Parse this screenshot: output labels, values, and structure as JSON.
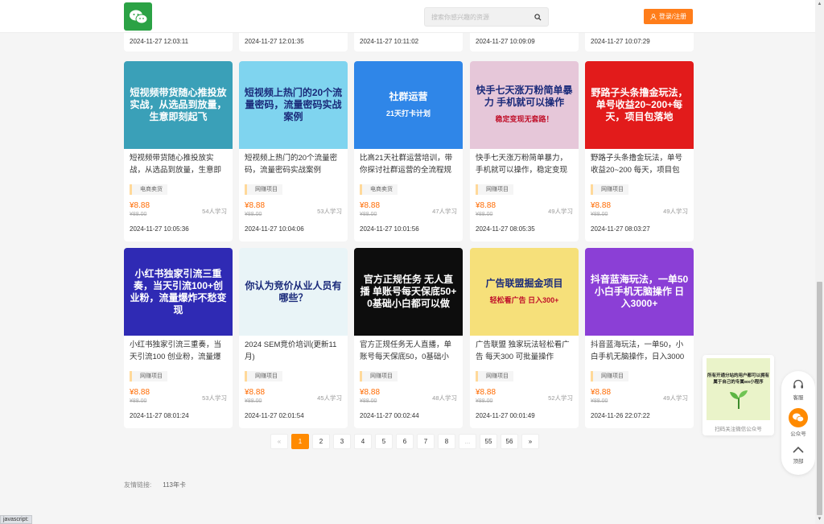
{
  "header": {
    "search_placeholder": "搜索你感兴趣的资源",
    "login_label": "登录/注册"
  },
  "top_dates": [
    "2024-11-27 12:03:11",
    "2024-11-27 12:01:35",
    "2024-11-27 10:11:02",
    "2024-11-27 10:09:09",
    "2024-11-27 10:07:29"
  ],
  "cards": [
    {
      "thumb_text": "短视频带货随心推投放实战，从选品到放量，生意即刻起飞",
      "thumb_bg": "#3aa0b8",
      "title": "短视频带货随心推投放实战，从选品到放量，生意即",
      "tag": "电商卖货",
      "price": "¥8.88",
      "old_price": "¥88.00",
      "learners": "54人学习",
      "date": "2024-11-27 10:05:36"
    },
    {
      "thumb_text": "短视频上热门的20个流量密码，流量密码实战案例",
      "thumb_bg": "#7fd4ef",
      "title": "短视频上热门的20个流量密码，流量密码实战案例",
      "tag": "网赚项目",
      "price": "¥8.88",
      "old_price": "¥88.00",
      "learners": "53人学习",
      "date": "2024-11-27 10:04:06"
    },
    {
      "thumb_text": "社群运营",
      "thumb_sub": "21天打卡计划",
      "thumb_bg": "#2f86e8",
      "title": "比高21天社群运营培训，带你探讨社群运营的全流程规",
      "tag": "电商卖货",
      "price": "¥8.88",
      "old_price": "¥88.00",
      "learners": "47人学习",
      "date": "2024-11-27 10:01:56"
    },
    {
      "thumb_text": "快手七天涨万粉简单暴力 手机就可以操作",
      "thumb_sub": "稳定变现无套路！",
      "thumb_bg": "#e6c7d9",
      "title": "快手七天涨万粉简单暴力，手机就可以操作，稳定变现",
      "tag": "网赚项目",
      "price": "¥8.88",
      "old_price": "¥88.00",
      "learners": "49人学习",
      "date": "2024-11-27 08:05:35"
    },
    {
      "thumb_text": "野路子头条撸金玩法，单号收益20~200+每天，项目包落地",
      "thumb_bg": "#e21b1b",
      "title": "野路子头条撸金玩法，单号收益20~200 每天，项目包",
      "tag": "网赚项目",
      "price": "¥8.88",
      "old_price": "¥88.00",
      "learners": "49人学习",
      "date": "2024-11-27 08:03:27"
    },
    {
      "thumb_text": "小红书独家引流三重奏，当天引流100+创业粉，流量爆炸不愁变现",
      "thumb_bg": "#2f2ab4",
      "title": "小红书独家引流三重奏，当天引流100 创业粉，流量爆",
      "tag": "网赚项目",
      "price": "¥8.88",
      "old_price": "¥88.00",
      "learners": "53人学习",
      "date": "2024-11-27 08:01:24"
    },
    {
      "thumb_text": "你认为竞价从业人员有哪些？",
      "thumb_bg": "#e9f4f7",
      "title": "2024 SEM竞价培训(更新11月)",
      "tag": "网赚项目",
      "price": "¥8.88",
      "old_price": "¥88.00",
      "learners": "45人学习",
      "date": "2024-11-27 02:01:54"
    },
    {
      "thumb_text": "官方正规任务 无人直播 单账号每天保底50+ 0基础小白都可以做",
      "thumb_bg": "#0d0d0d",
      "title": "官方正规任务无人直播，单账号每天保底50，0基础小",
      "tag": "网赚项目",
      "price": "¥8.88",
      "old_price": "¥88.00",
      "learners": "48人学习",
      "date": "2024-11-27 00:02:44"
    },
    {
      "thumb_text": "广告联盟掘金项目",
      "thumb_sub": "轻松看广告 日入300+",
      "thumb_bg": "#f6e07a",
      "title": "广告联盟 独家玩法轻松看广告 每天300 可批量操作",
      "tag": "网赚项目",
      "price": "¥8.88",
      "old_price": "¥88.00",
      "learners": "52人学习",
      "date": "2024-11-27 00:01:49"
    },
    {
      "thumb_text": "抖音蓝海玩法，一单50 小白手机无脑操作 日入3000+",
      "thumb_bg": "#8b3fd6",
      "title": "抖音蓝海玩法，一单50，小白手机无脑操作，日入3000",
      "tag": "网赚项目",
      "price": "¥8.88",
      "old_price": "¥88.00",
      "learners": "49人学习",
      "date": "2024-11-26 22:07:22"
    }
  ],
  "pagination": {
    "prev": "«",
    "pages": [
      "1",
      "2",
      "3",
      "4",
      "5",
      "6",
      "7",
      "8"
    ],
    "ellipsis": "...",
    "tail": [
      "55",
      "56"
    ],
    "next": "»",
    "current": "1"
  },
  "footer": {
    "links_label": "友情链接:",
    "link1": "113年卡"
  },
  "side": {
    "qr_text": "所有开通分站的用户都可以拥有属于自己的专属wx小程序",
    "qr_caption": "扫码关注微信公众号",
    "kefu": "客服",
    "gongzhonghao": "公众号",
    "top": "顶部"
  },
  "status_text": "javascript:",
  "colors": {
    "accent": "#ff7d1a",
    "price": "#ff6a00",
    "wechat": "#2ba245"
  }
}
